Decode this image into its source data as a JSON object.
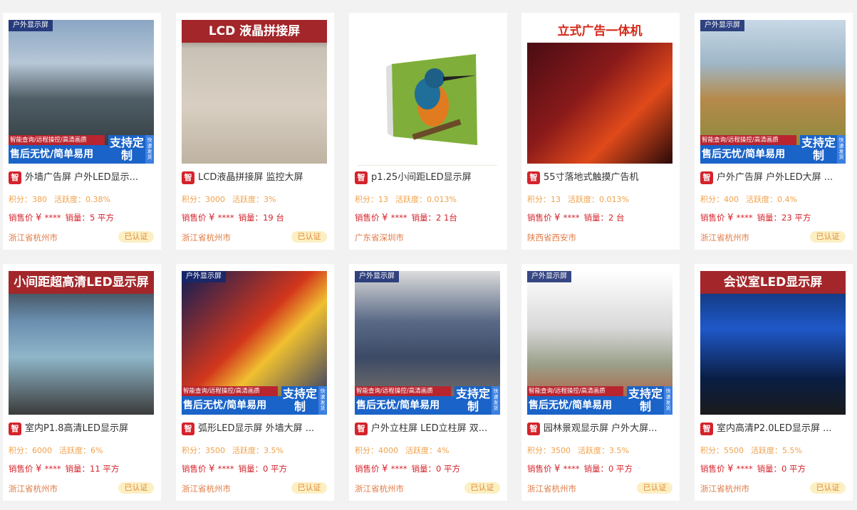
{
  "labels": {
    "stats_score": "积分：",
    "stats_activity": "活跃度：",
    "price_label": "销售价",
    "price_currency": "¥",
    "price_masked": "****",
    "volume_label": "销量：",
    "certified": "已认证",
    "brand_char": "智"
  },
  "promo": {
    "features": "智能查询/远程操控/高清画质",
    "service": "售后无忧/简单易用",
    "support": "支持定制",
    "fast": "快速发货"
  },
  "cards": [
    {
      "title": "外墙广告屏 户外LED显示...",
      "score": "380",
      "activity": "0.38%",
      "volume": "5 平方",
      "location": "浙江省杭州市",
      "certified": true,
      "thumb_label": "户外显示屏",
      "band": "",
      "promo": true,
      "theme": "outdoor"
    },
    {
      "title": "LCD液晶拼接屏 监控大屏",
      "score": "3000",
      "activity": "3%",
      "volume": "19 台",
      "location": "浙江省杭州市",
      "certified": true,
      "thumb_label": "",
      "band": "LCD 液晶拼接屏",
      "promo": false,
      "theme": "lcdwall"
    },
    {
      "title": "p1.25小间距LED显示屏",
      "score": "13",
      "activity": "0.013%",
      "volume": "2 1台",
      "location": "广东省深圳市",
      "certified": false,
      "thumb_label": "",
      "band": "",
      "promo": false,
      "theme": "bird"
    },
    {
      "title": "55寸落地式触摸广告机",
      "score": "13",
      "activity": "0.013%",
      "volume": "2 台",
      "location": "陕西省西安市",
      "certified": false,
      "thumb_label": "",
      "band": "立式广告一体机",
      "promo": false,
      "theme": "kiosk"
    },
    {
      "title": "户外广告屏 户外LED大屏 ...",
      "score": "400",
      "activity": "0.4%",
      "volume": "23 平方",
      "location": "浙江省杭州市",
      "certified": true,
      "thumb_label": "户外显示屏",
      "band": "",
      "promo": true,
      "theme": "pavilion"
    },
    {
      "title": "室内P1.8高清LED显示屏",
      "score": "6000",
      "activity": "6%",
      "volume": "11 平方",
      "location": "浙江省杭州市",
      "certified": true,
      "thumb_label": "",
      "band": "小间距超高清LED显示屏",
      "promo": false,
      "theme": "squirrel"
    },
    {
      "title": "弧形LED显示屏 外墙大屏 ...",
      "score": "3500",
      "activity": "3.5%",
      "volume": "0 平方",
      "location": "浙江省杭州市",
      "certified": true,
      "thumb_label": "户外显示屏",
      "band": "",
      "promo": true,
      "theme": "curved"
    },
    {
      "title": "户外立柱屏 LED立柱屏 双...",
      "score": "4000",
      "activity": "4%",
      "volume": "0 平方",
      "location": "浙江省杭州市",
      "certified": true,
      "thumb_label": "户外显示屏",
      "band": "",
      "promo": true,
      "theme": "pillar"
    },
    {
      "title": "园林景观显示屏 户外大屏...",
      "score": "3500",
      "activity": "3.5%",
      "volume": "0 平方",
      "location": "浙江省杭州市",
      "certified": true,
      "thumb_label": "户外显示屏",
      "band": "",
      "promo": true,
      "theme": "garden"
    },
    {
      "title": "室内高清P2.0LED显示屏 ...",
      "score": "5500",
      "activity": "5.5%",
      "volume": "0 平方",
      "location": "浙江省杭州市",
      "certified": true,
      "thumb_label": "",
      "band": "会议室LED显示屏",
      "promo": false,
      "theme": "meeting"
    }
  ]
}
